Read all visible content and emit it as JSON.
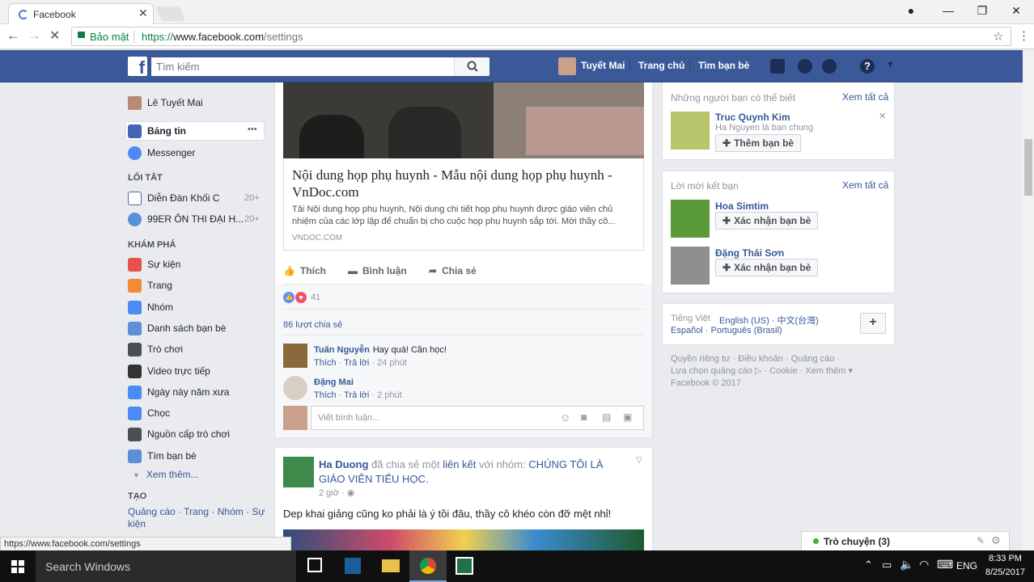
{
  "browser": {
    "tab_title": "Facebook",
    "secure_label": "Bảo mật",
    "url_scheme": "https://",
    "url_host": "www.facebook.com",
    "url_path": "/settings",
    "status_url": "https://www.facebook.com/settings"
  },
  "fb_header": {
    "logo": "f",
    "search_placeholder": "Tìm kiếm",
    "user_name": "Tuyết Mai",
    "home": "Trang chủ",
    "find_friends": "Tìm bạn bè"
  },
  "left_nav": {
    "profile": "Lê Tuyết Mai",
    "main": [
      {
        "label": "Bảng tin",
        "icon": "news-feed-icon",
        "color": "#4267b2"
      },
      {
        "label": "Messenger",
        "icon": "messenger-icon",
        "color": "#4c8bf5"
      }
    ],
    "more_dots": "•••",
    "shortcuts_heading": "LỐI TẮT",
    "shortcuts": [
      {
        "label": "Diễn Đàn Khối C",
        "count": "20+"
      },
      {
        "label": "99ER ÔN THI ĐẠI H...",
        "count": "20+"
      }
    ],
    "explore_heading": "KHÁM PHÁ",
    "explore": [
      {
        "label": "Sự kiện",
        "icon": "calendar-icon",
        "color": "#e9514b"
      },
      {
        "label": "Trang",
        "icon": "flag-icon",
        "color": "#f28b38"
      },
      {
        "label": "Nhóm",
        "icon": "groups-icon",
        "color": "#4c8bf5"
      },
      {
        "label": "Danh sách bạn bè",
        "icon": "friends-list-icon",
        "color": "#5b8fd9"
      },
      {
        "label": "Trò chơi",
        "icon": "games-icon",
        "color": "#4b4f56"
      },
      {
        "label": "Video trực tiếp",
        "icon": "live-video-icon",
        "color": "#333333"
      },
      {
        "label": "Ngày này năm xưa",
        "icon": "memories-icon",
        "color": "#4c8bf5"
      },
      {
        "label": "Chọc",
        "icon": "poke-icon",
        "color": "#4c8bf5"
      },
      {
        "label": "Nguồn cấp trò chơi",
        "icon": "gamepad-icon",
        "color": "#4b4f56"
      },
      {
        "label": "Tìm bạn bè",
        "icon": "find-friends-icon",
        "color": "#5b8fd9"
      }
    ],
    "see_more": "Xem thêm...",
    "create_heading": "TẠO",
    "create_line1": "Quảng cáo · Trang · Nhóm · Sự",
    "create_line2": "kiện"
  },
  "post1": {
    "link_title": "Nội dung họp phụ huynh - Mẫu nội dung họp phụ huynh - VnDoc.com",
    "link_desc": "Tải Nội dung họp phụ huynh, Nội dung chi tiết họp phụ huynh được giáo viên chủ nhiệm của các lớp lập để chuẩn bị cho cuộc họp phụ huynh sắp tới. Mời thầy cô...",
    "link_domain": "VNDOC.COM",
    "like": "Thích",
    "comment": "Bình luận",
    "share": "Chia sẻ",
    "reaction_count": "41",
    "shares": "86 lượt chia sẻ",
    "comments": [
      {
        "author": "Tuấn Nguyễn",
        "text": "Hay quá! Cần học!",
        "like": "Thích",
        "reply": "Trả lời",
        "time": "24 phút"
      },
      {
        "author": "Đặng Mai",
        "text": "",
        "like": "Thích",
        "reply": "Trả lời",
        "time": "2 phút"
      }
    ],
    "comment_placeholder": "Viết bình luận..."
  },
  "post2": {
    "author": "Ha Duong",
    "verb1": "đã chia sẻ một",
    "link_word": "liên kết",
    "verb2": "với nhóm:",
    "group": "CHÚNG TÔI LÀ GIÁO VIÊN TIỂU HỌC.",
    "time": "2 giờ",
    "text": "Dep khai giảng cũng ko phải là ý tồi đâu, thầy cô khéo còn đỡ mệt nhỉ!"
  },
  "pymk": {
    "heading": "Những người bạn có thể biết",
    "see_all": "Xem tất cả",
    "name": "Truc Quynh Kim",
    "mutual": "Ha Nguyen là bạn chung",
    "add_btn": "Thêm bạn bè"
  },
  "requests": {
    "heading": "Lời mời kết bạn",
    "see_all": "Xem tất cả",
    "items": [
      {
        "name": "Hoa Simtim",
        "btn": "Xác nhận bạn bè"
      },
      {
        "name": "Đặng Thái Sơn",
        "btn": "Xác nhận bạn bè"
      }
    ]
  },
  "languages": {
    "current": "Tiếng Việt",
    "list1": "English (US) · 中文(台灣)",
    "list2": "Español · Português (Brasil)",
    "plus": "+"
  },
  "footer": {
    "line1": "Quyền riêng tư · Điều khoản · Quảng cáo ·",
    "line2": "Lựa chọn quảng cáo ▷ · Cookie · Xem thêm ▾",
    "line3": "Facebook © 2017"
  },
  "chat": {
    "label": "Trò chuyện (3)"
  },
  "taskbar": {
    "search": "Search Windows",
    "lang": "ENG",
    "time": "8:33 PM",
    "date": "8/25/2017"
  }
}
